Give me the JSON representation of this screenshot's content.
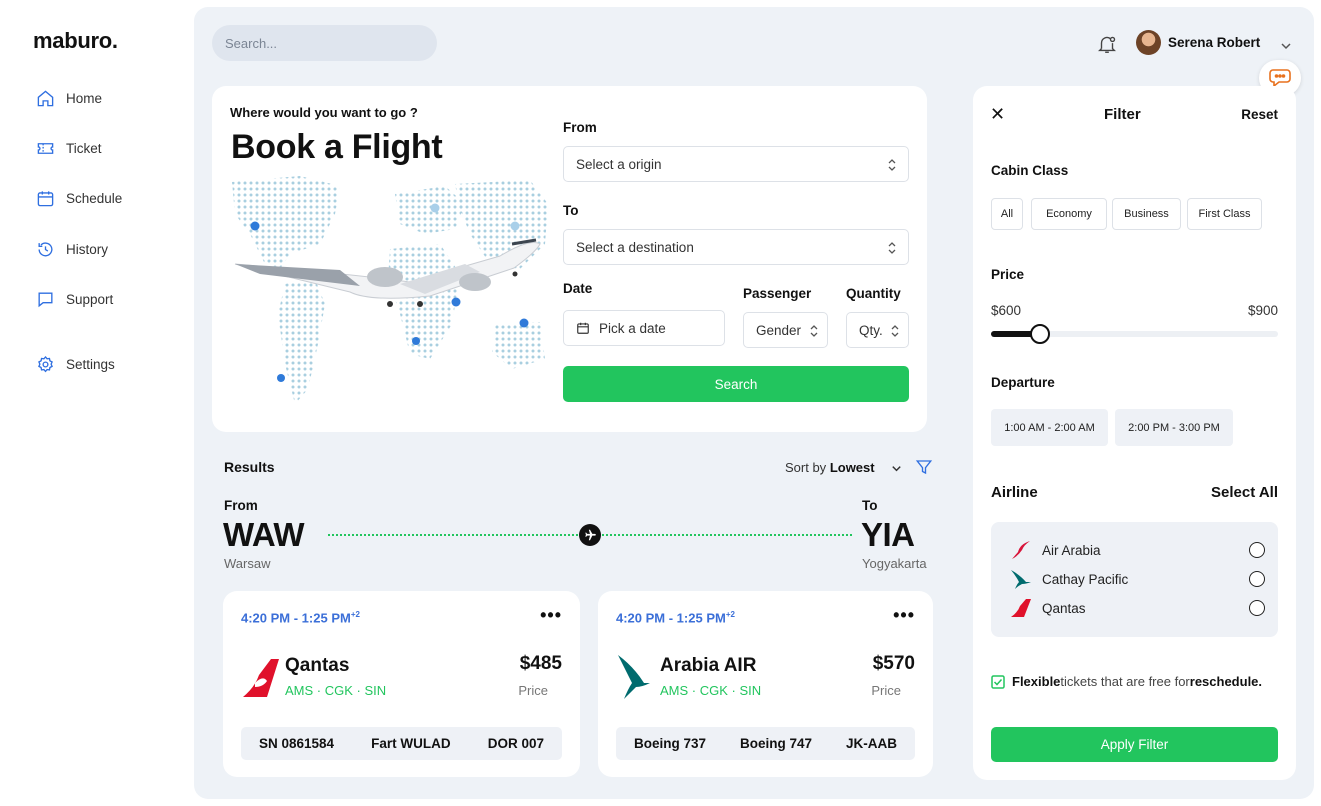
{
  "brand": "maburo.",
  "nav": [
    {
      "label": "Home",
      "icon": "home-icon"
    },
    {
      "label": "Ticket",
      "icon": "ticket-icon"
    },
    {
      "label": "Schedule",
      "icon": "calendar-icon"
    },
    {
      "label": "History",
      "icon": "history-icon"
    },
    {
      "label": "Support",
      "icon": "chat-icon"
    },
    {
      "label": "Settings",
      "icon": "gear-icon"
    }
  ],
  "header": {
    "search_placeholder": "Search...",
    "user_name": "Serena Robert"
  },
  "booking": {
    "question": "Where would you want to go ?",
    "title": "Book a Flight",
    "from_label": "From",
    "from_placeholder": "Select a origin",
    "to_label": "To",
    "to_placeholder": "Select a destination",
    "date_label": "Date",
    "date_placeholder": "Pick a date",
    "passenger_label": "Passenger",
    "passenger_value": "Gender",
    "quantity_label": "Quantity",
    "quantity_value": "Qty.",
    "search_button": "Search"
  },
  "results": {
    "title": "Results",
    "sort_prefix": "Sort by",
    "sort_value": "Lowest",
    "from_label": "From",
    "from_code": "WAW",
    "from_city": "Warsaw",
    "to_label": "To",
    "to_code": "YIA",
    "to_city": "Yogyakarta",
    "flights": [
      {
        "time": "4:20 PM - 1:25 PM",
        "time_sup": "+2",
        "airline": "Qantas",
        "stops": "AMS  · CGK  · SIN",
        "price": "$485",
        "price_label": "Price",
        "details": [
          "SN 0861584",
          "Fart WULAD",
          "DOR 007"
        ]
      },
      {
        "time": "4:20 PM - 1:25 PM",
        "time_sup": "+2",
        "airline": "Arabia AIR",
        "stops": "AMS  · CGK  · SIN",
        "price": "$570",
        "price_label": "Price",
        "details": [
          "Boeing 737",
          "Boeing 747",
          "JK-AAB"
        ]
      }
    ]
  },
  "filter": {
    "title": "Filter",
    "reset": "Reset",
    "cabin_label": "Cabin Class",
    "cabin_options": [
      "All",
      "Economy",
      "Business",
      "First Class"
    ],
    "price_label": "Price",
    "price_min": "$600",
    "price_max": "$900",
    "price_slider_fraction": 0.17,
    "departure_label": "Departure",
    "departure_options": [
      "1:00 AM - 2:00 AM",
      "2:00 PM - 3:00 PM"
    ],
    "airline_label": "Airline",
    "select_all": "Select All",
    "airlines": [
      "Air Arabia",
      "Cathay Pacific",
      "Qantas"
    ],
    "flex_bold1": "Flexible",
    "flex_text": "tickets that are free for",
    "flex_bold2": "reschedule.",
    "apply_button": "Apply Filter"
  },
  "colors": {
    "accent_green": "#22c55e",
    "accent_blue": "#2f6fe0",
    "background": "#eef2f7"
  }
}
